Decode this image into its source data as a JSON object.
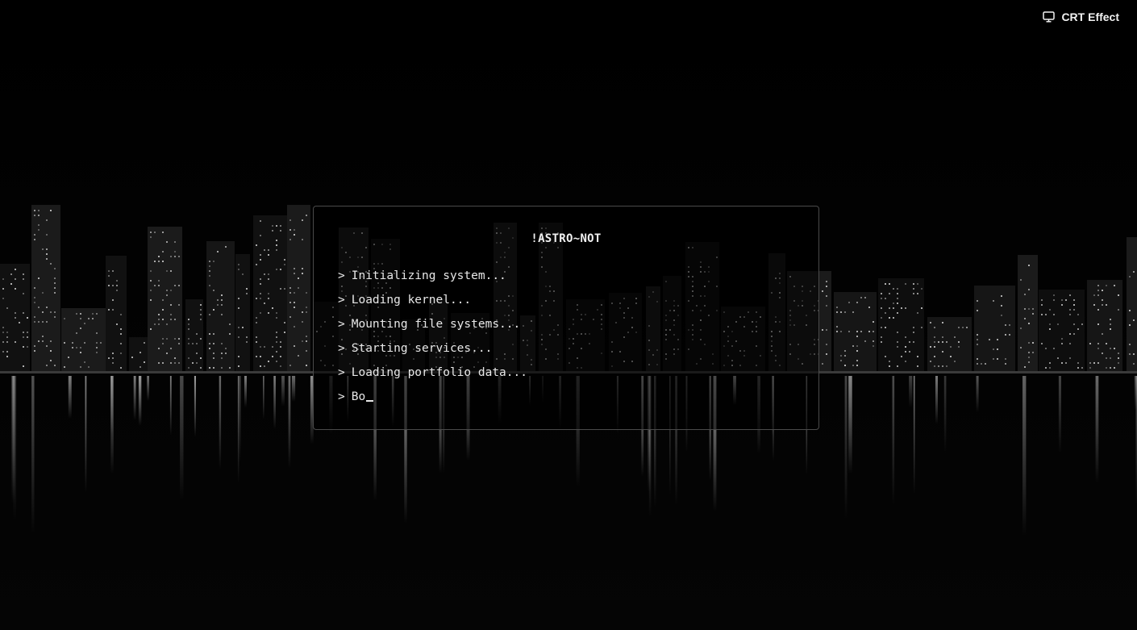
{
  "topbar": {
    "crt_label": "CRT Effect",
    "crt_icon": "monitor-icon"
  },
  "terminal": {
    "title": "!ASTRO~NOT",
    "prompt": ">",
    "lines": [
      "Initializing system...",
      "Loading kernel...",
      "Mounting file systems...",
      "Starting services...",
      "Loading portfolio data...",
      "Bo"
    ]
  },
  "colors": {
    "background": "#000000",
    "text": "#e8e8e8",
    "border": "#4a4a4a"
  }
}
